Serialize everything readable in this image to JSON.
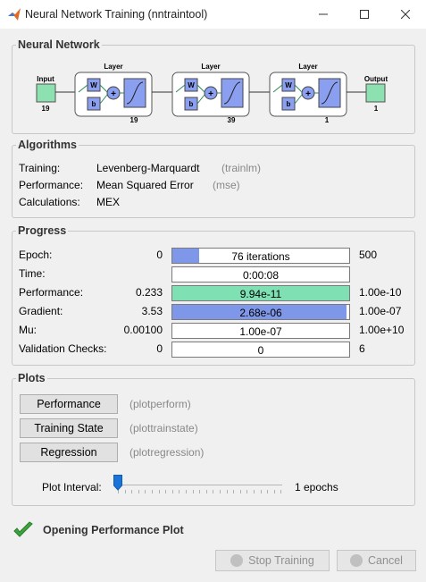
{
  "window": {
    "title": "Neural Network Training (nntraintool)"
  },
  "network": {
    "section_title": "Neural Network",
    "input_label": "Input",
    "input_size": "19",
    "output_label": "Output",
    "output_size": "1",
    "layers": [
      {
        "label": "Layer",
        "size": "19",
        "w": "W",
        "b": "b",
        "plus": "+"
      },
      {
        "label": "Layer",
        "size": "39",
        "w": "W",
        "b": "b",
        "plus": "+"
      },
      {
        "label": "Layer",
        "size": "1",
        "w": "W",
        "b": "b",
        "plus": "+"
      }
    ]
  },
  "algorithms": {
    "section_title": "Algorithms",
    "rows": [
      {
        "label": "Training:",
        "value": "Levenberg-Marquardt",
        "fn": "(trainlm)"
      },
      {
        "label": "Performance:",
        "value": "Mean Squared Error",
        "fn": "(mse)"
      },
      {
        "label": "Calculations:",
        "value": "MEX",
        "fn": ""
      }
    ]
  },
  "progress": {
    "section_title": "Progress",
    "rows": [
      {
        "label": "Epoch:",
        "start": "0",
        "bar_text": "76 iterations",
        "end": "500",
        "fill_fraction": 0.152,
        "fill_color": "#7f97e8"
      },
      {
        "label": "Time:",
        "start": "",
        "bar_text": "0:00:08",
        "end": "",
        "fill_fraction": 0,
        "fill_color": "#ffffff"
      },
      {
        "label": "Performance:",
        "start": "0.233",
        "bar_text": "9.94e-11",
        "end": "1.00e-10",
        "fill_fraction": 1.0,
        "fill_color": "#7fe0b4"
      },
      {
        "label": "Gradient:",
        "start": "3.53",
        "bar_text": "2.68e-06",
        "end": "1.00e-07",
        "fill_fraction": 0.985,
        "fill_color": "#7f97e8"
      },
      {
        "label": "Mu:",
        "start": "0.00100",
        "bar_text": "1.00e-07",
        "end": "1.00e+10",
        "fill_fraction": 0,
        "fill_color": "#ffffff"
      },
      {
        "label": "Validation Checks:",
        "start": "0",
        "bar_text": "0",
        "end": "6",
        "fill_fraction": 0,
        "fill_color": "#ffffff"
      }
    ]
  },
  "plots": {
    "section_title": "Plots",
    "buttons": [
      {
        "label": "Performance",
        "fn": "(plotperform)"
      },
      {
        "label": "Training State",
        "fn": "(plottrainstate)"
      },
      {
        "label": "Regression",
        "fn": "(plotregression)"
      }
    ],
    "interval_label": "Plot Interval:",
    "interval_value": "1 epochs"
  },
  "status": {
    "text": "Opening Performance Plot"
  },
  "footer": {
    "stop_label": "Stop Training",
    "cancel_label": "Cancel"
  },
  "colors": {
    "neuron_fill": "#8de0b0",
    "weight_fill": "#8b9ff0",
    "check_green": "#3aa53a"
  }
}
